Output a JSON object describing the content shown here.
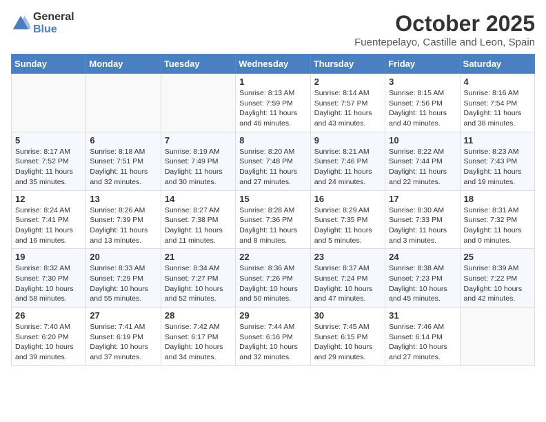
{
  "header": {
    "logo_general": "General",
    "logo_blue": "Blue",
    "month": "October 2025",
    "location": "Fuentepelayo, Castille and Leon, Spain"
  },
  "weekdays": [
    "Sunday",
    "Monday",
    "Tuesday",
    "Wednesday",
    "Thursday",
    "Friday",
    "Saturday"
  ],
  "weeks": [
    [
      {
        "day": "",
        "info": ""
      },
      {
        "day": "",
        "info": ""
      },
      {
        "day": "",
        "info": ""
      },
      {
        "day": "1",
        "info": "Sunrise: 8:13 AM\nSunset: 7:59 PM\nDaylight: 11 hours and 46 minutes."
      },
      {
        "day": "2",
        "info": "Sunrise: 8:14 AM\nSunset: 7:57 PM\nDaylight: 11 hours and 43 minutes."
      },
      {
        "day": "3",
        "info": "Sunrise: 8:15 AM\nSunset: 7:56 PM\nDaylight: 11 hours and 40 minutes."
      },
      {
        "day": "4",
        "info": "Sunrise: 8:16 AM\nSunset: 7:54 PM\nDaylight: 11 hours and 38 minutes."
      }
    ],
    [
      {
        "day": "5",
        "info": "Sunrise: 8:17 AM\nSunset: 7:52 PM\nDaylight: 11 hours and 35 minutes."
      },
      {
        "day": "6",
        "info": "Sunrise: 8:18 AM\nSunset: 7:51 PM\nDaylight: 11 hours and 32 minutes."
      },
      {
        "day": "7",
        "info": "Sunrise: 8:19 AM\nSunset: 7:49 PM\nDaylight: 11 hours and 30 minutes."
      },
      {
        "day": "8",
        "info": "Sunrise: 8:20 AM\nSunset: 7:48 PM\nDaylight: 11 hours and 27 minutes."
      },
      {
        "day": "9",
        "info": "Sunrise: 8:21 AM\nSunset: 7:46 PM\nDaylight: 11 hours and 24 minutes."
      },
      {
        "day": "10",
        "info": "Sunrise: 8:22 AM\nSunset: 7:44 PM\nDaylight: 11 hours and 22 minutes."
      },
      {
        "day": "11",
        "info": "Sunrise: 8:23 AM\nSunset: 7:43 PM\nDaylight: 11 hours and 19 minutes."
      }
    ],
    [
      {
        "day": "12",
        "info": "Sunrise: 8:24 AM\nSunset: 7:41 PM\nDaylight: 11 hours and 16 minutes."
      },
      {
        "day": "13",
        "info": "Sunrise: 8:26 AM\nSunset: 7:39 PM\nDaylight: 11 hours and 13 minutes."
      },
      {
        "day": "14",
        "info": "Sunrise: 8:27 AM\nSunset: 7:38 PM\nDaylight: 11 hours and 11 minutes."
      },
      {
        "day": "15",
        "info": "Sunrise: 8:28 AM\nSunset: 7:36 PM\nDaylight: 11 hours and 8 minutes."
      },
      {
        "day": "16",
        "info": "Sunrise: 8:29 AM\nSunset: 7:35 PM\nDaylight: 11 hours and 5 minutes."
      },
      {
        "day": "17",
        "info": "Sunrise: 8:30 AM\nSunset: 7:33 PM\nDaylight: 11 hours and 3 minutes."
      },
      {
        "day": "18",
        "info": "Sunrise: 8:31 AM\nSunset: 7:32 PM\nDaylight: 11 hours and 0 minutes."
      }
    ],
    [
      {
        "day": "19",
        "info": "Sunrise: 8:32 AM\nSunset: 7:30 PM\nDaylight: 10 hours and 58 minutes."
      },
      {
        "day": "20",
        "info": "Sunrise: 8:33 AM\nSunset: 7:29 PM\nDaylight: 10 hours and 55 minutes."
      },
      {
        "day": "21",
        "info": "Sunrise: 8:34 AM\nSunset: 7:27 PM\nDaylight: 10 hours and 52 minutes."
      },
      {
        "day": "22",
        "info": "Sunrise: 8:36 AM\nSunset: 7:26 PM\nDaylight: 10 hours and 50 minutes."
      },
      {
        "day": "23",
        "info": "Sunrise: 8:37 AM\nSunset: 7:24 PM\nDaylight: 10 hours and 47 minutes."
      },
      {
        "day": "24",
        "info": "Sunrise: 8:38 AM\nSunset: 7:23 PM\nDaylight: 10 hours and 45 minutes."
      },
      {
        "day": "25",
        "info": "Sunrise: 8:39 AM\nSunset: 7:22 PM\nDaylight: 10 hours and 42 minutes."
      }
    ],
    [
      {
        "day": "26",
        "info": "Sunrise: 7:40 AM\nSunset: 6:20 PM\nDaylight: 10 hours and 39 minutes."
      },
      {
        "day": "27",
        "info": "Sunrise: 7:41 AM\nSunset: 6:19 PM\nDaylight: 10 hours and 37 minutes."
      },
      {
        "day": "28",
        "info": "Sunrise: 7:42 AM\nSunset: 6:17 PM\nDaylight: 10 hours and 34 minutes."
      },
      {
        "day": "29",
        "info": "Sunrise: 7:44 AM\nSunset: 6:16 PM\nDaylight: 10 hours and 32 minutes."
      },
      {
        "day": "30",
        "info": "Sunrise: 7:45 AM\nSunset: 6:15 PM\nDaylight: 10 hours and 29 minutes."
      },
      {
        "day": "31",
        "info": "Sunrise: 7:46 AM\nSunset: 6:14 PM\nDaylight: 10 hours and 27 minutes."
      },
      {
        "day": "",
        "info": ""
      }
    ]
  ]
}
